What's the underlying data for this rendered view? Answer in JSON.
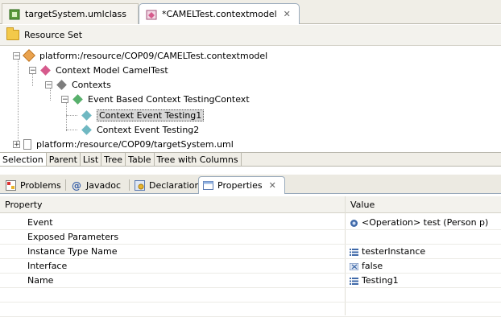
{
  "editor_tabs": [
    {
      "label": "targetSystem.umlclass",
      "active": false
    },
    {
      "label": "*CAMELTest.contextmodel",
      "active": true,
      "close": "✕"
    }
  ],
  "resource_header": "Resource Set",
  "tree": [
    {
      "label": "platform:/resource/COP09/CAMELTest.contextmodel",
      "toggle": "−"
    },
    {
      "label": "Context Model CamelTest",
      "toggle": "−"
    },
    {
      "label": "Contexts",
      "toggle": "−"
    },
    {
      "label": "Event Based Context TestingContext",
      "toggle": "−"
    },
    {
      "label": "Context Event Testing1",
      "selected": true
    },
    {
      "label": "Context Event Testing2"
    },
    {
      "label": "platform:/resource/COP09/targetSystem.uml",
      "toggle": "+"
    }
  ],
  "view_tabs": [
    "Selection",
    "Parent",
    "List",
    "Tree",
    "Table",
    "Tree with Columns"
  ],
  "panel_tabs": [
    {
      "label": "Problems",
      "icon": "problems-icon"
    },
    {
      "label": "Javadoc",
      "icon": "at-icon"
    },
    {
      "label": "Declaration",
      "icon": "declaration-icon"
    },
    {
      "label": "Properties",
      "icon": "properties-icon",
      "active": true,
      "close": "✕"
    }
  ],
  "properties": {
    "headers": {
      "property": "Property",
      "value": "Value"
    },
    "rows": [
      {
        "property": "Event",
        "value": "<Operation> test (Person p)",
        "icon": "operation-icon"
      },
      {
        "property": "Exposed Parameters",
        "value": ""
      },
      {
        "property": "Instance Type Name",
        "value": "testerInstance",
        "icon": "text-value-icon"
      },
      {
        "property": "Interface",
        "value": "false",
        "icon": "boolean-icon"
      },
      {
        "property": "Name",
        "value": "Testing1",
        "icon": "text-value-icon"
      }
    ]
  }
}
